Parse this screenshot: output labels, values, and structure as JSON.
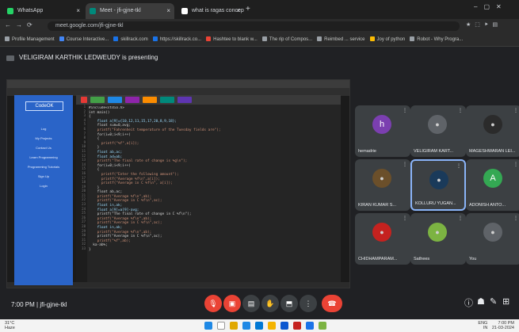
{
  "browser": {
    "tabs": [
      {
        "label": "WhatsApp",
        "active": false,
        "color": "#25d366"
      },
      {
        "label": "Meet - jfi-gjne-tkl",
        "active": true,
        "color": "#00897b"
      },
      {
        "label": "what is ragas concept in u... Goo",
        "active": false,
        "color": "#ffffff"
      }
    ],
    "new_tab": "+",
    "url": "meet.google.com/jfi-gjne-tkl",
    "bookmarks": [
      {
        "label": "Profile Management",
        "color": "#9aa0a6"
      },
      {
        "label": "Course Interactive...",
        "color": "#4285f4"
      },
      {
        "label": "skillrack.com",
        "color": "#1a73e8"
      },
      {
        "label": "https://skillrack.co...",
        "color": "#1a73e8"
      },
      {
        "label": "Hashtee to blank w...",
        "color": "#ea4335"
      },
      {
        "label": "The rip of Compos...",
        "color": "#9aa0a6"
      },
      {
        "label": "Reimbed ... service",
        "color": "#9aa0a6"
      },
      {
        "label": "Joy of python",
        "color": "#fbbc04"
      },
      {
        "label": "Robot - Why Progra...",
        "color": "#9aa0a6"
      }
    ]
  },
  "meet": {
    "presenting_label": "VELIGIRAM KARTHIK LEDWEUDY is presenting",
    "time": "7:00 PM",
    "separator": "|",
    "meeting_code": "jfi-gjne-tkl",
    "participants": [
      {
        "name": "hemadrie",
        "initial": "h",
        "avatar_color": "#7b3fb0",
        "photo": false
      },
      {
        "name": "VELIGIRAM KART...",
        "initial": "",
        "avatar_color": "#5f6368",
        "photo": true
      },
      {
        "name": "MAGESHWARAN LEI...",
        "initial": "",
        "avatar_color": "#2b2b2b",
        "photo": true
      },
      {
        "name": "KIRAN KUMAR S...",
        "initial": "",
        "avatar_color": "#6b4f2a",
        "photo": true
      },
      {
        "name": "KOLLURU YUGAN...",
        "initial": "",
        "avatar_color": "#1a3a5a",
        "photo": true,
        "speaking": true
      },
      {
        "name": "ADONISH ANTO...",
        "initial": "A",
        "avatar_color": "#34a853",
        "photo": false
      },
      {
        "name": "CHIDHAMPARAM...",
        "initial": "",
        "avatar_color": "#c5221f",
        "photo": true
      },
      {
        "name": "Sathees",
        "initial": "",
        "avatar_color": "#7cb342",
        "photo": true
      },
      {
        "name": "You",
        "initial": "",
        "avatar_color": "#5f6368",
        "photo": true
      }
    ],
    "controls": [
      {
        "name": "mic-off",
        "glyph": "🎙",
        "color": "#ea4335"
      },
      {
        "name": "camera-off",
        "glyph": "▣",
        "color": "#ea4335"
      },
      {
        "name": "captions",
        "glyph": "▤",
        "color": "#3c4043"
      },
      {
        "name": "raise-hand",
        "glyph": "✋",
        "color": "#3c4043"
      },
      {
        "name": "present",
        "glyph": "⬒",
        "color": "#3c4043"
      },
      {
        "name": "more",
        "glyph": "⋮",
        "color": "#3c4043"
      },
      {
        "name": "leave-call",
        "glyph": "☎",
        "color": "#ea4335"
      }
    ],
    "right_controls": [
      "ⓘ",
      "☗",
      "✎",
      "⊞"
    ]
  },
  "shared_screen": {
    "sidebar": {
      "logo": "CodeOK",
      "items": [
        "Log",
        "My Projects",
        "Contact Us",
        "Learn Programming",
        "Programming Tutorials",
        "Sign Up",
        "Login"
      ]
    },
    "code_lines": [
      "#include<stdio.h>",
      "int main()",
      "{",
      "    float a[9]={10,12,11,15,17,20,8,9,18};",
      "    float sum=0,avg;",
      "    printf(\"Fahrenheit temperature of the Tuesday fields are\");",
      "    for(i=0;i<9;i++)",
      "    {",
      "      printf(\"%f\",a[i]);",
      "    }",
      "    float ab,ac;",
      "    float ad=ab;",
      "    printf(\"The final rate of change is %g\\n\");",
      "    for(i=0;i<9;i++)",
      "    {",
      "      printf(\"Enter the following amount\");",
      "      printf(\"Average %f\\n\",a[i]);",
      "      printf(\"Average in C %f\\n\", a[i]);",
      "    }",
      "    float ab,ac;",
      "    printf(\"Average %f\\n\",ab);",
      "    printf(\"Average in C %f\\n\",ac);",
      "    float in,ak;",
      "    float a[9]=a[9]-avg;",
      "    printf(\"The final rate of change in C %f\\n\");",
      "    printf(\"Average %f\\n\",ab);",
      "    printf(\"Average in C %f\\n\",ac);",
      "    float in,ak;",
      "    printf(\"Average %f\\n\",ab);",
      "    printf(\"Average in C %f\\n\",ac);",
      "    printf(\"%f\",ab);",
      "  ka-ab%;",
      "}"
    ]
  },
  "taskbar": {
    "weather": "31°C\nHaze",
    "time": "7:00 PM",
    "date": "21-03-2024",
    "lang": "ENG\nIN",
    "apps": [
      "#1e88e5",
      "#ffffff",
      "#e0a800",
      "#1e88e5",
      "#0078d4",
      "#f4b400",
      "#0b57d0",
      "#c5221f",
      "#1a73e8",
      "#7cb342"
    ]
  }
}
